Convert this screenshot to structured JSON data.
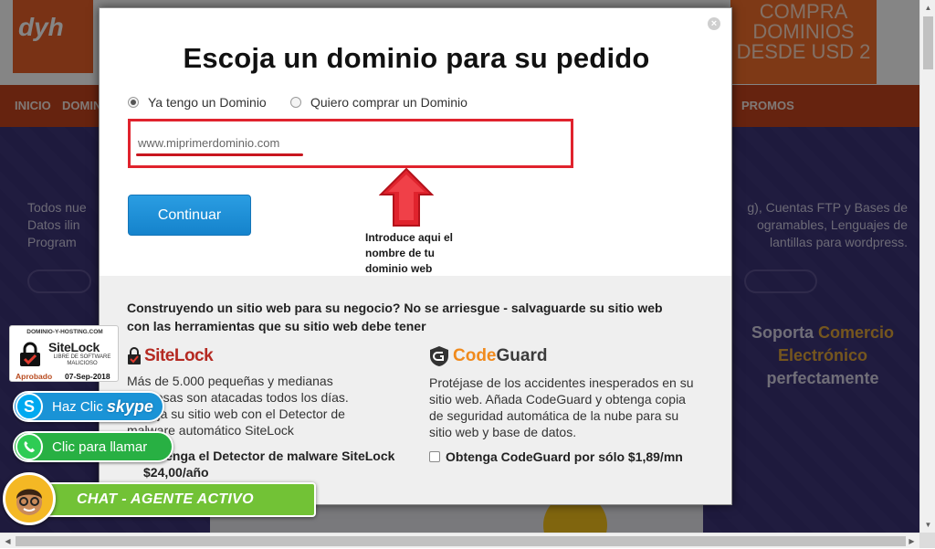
{
  "background": {
    "logo": "dyh",
    "promo_lines": [
      "COMPRA",
      "DOMINIOS",
      "DESDE USD 2"
    ],
    "nav_items": [
      "INICIO",
      "DOMINI",
      "PROMOS"
    ],
    "hero_left_lines": [
      "Todos nue",
      "Datos ilin",
      "Program"
    ],
    "hero_right_lines": [
      "g), Cuentas FTP y Bases de",
      "ogramables, Lenguajes de",
      "lantillas para wordpress."
    ],
    "soporta_prefix": "Soporta",
    "soporta_highlight": "Comercio Electrónico",
    "soporta_suffix": "perfectamente"
  },
  "modal": {
    "title": "Escoja un dominio para su pedido",
    "close_symbol": "×",
    "radio_options": [
      {
        "label": "Ya tengo un Dominio",
        "checked": true
      },
      {
        "label": "Quiero comprar un Dominio",
        "checked": false
      }
    ],
    "domain_input": {
      "value": "www.miprimerdominio.com",
      "placeholder": ""
    },
    "continue_label": "Continuar",
    "hint_text": "Introduce aqui el nombre de tu dominio web",
    "upsell": {
      "heading": "Construyendo un sitio web para su negocio? No se arriesgue - salvaguarde su sitio web con las herramientas que su sitio web debe tener",
      "sitelock": {
        "brand": "SiteLock",
        "description": "Más de 5.000 pequeñas y medianas empresas son atacadas todos los días. Proteja su sitio web con el Detector de malware automático SiteLock",
        "offer": "Obtenga el Detector de malware SiteLock $24,00/año"
      },
      "codeguard": {
        "brand_code": "Code",
        "brand_guard": "Guard",
        "description": "Protéjase de los accidentes inesperados en su sitio web. Añada CodeGuard y obtenga copia de seguridad automática de la nube para su sitio web y base de datos.",
        "offer": "Obtenga CodeGuard por sólo $1,89/mn"
      }
    }
  },
  "widgets": {
    "sitelock_badge": {
      "domain": "DOMINIO-Y-HOSTING.COM",
      "brand": "SiteLock",
      "sub1": "LIBRE DE SOFTWARE",
      "sub2": "MALICIOSO",
      "status": "Aprobado",
      "date": "07-Sep-2018"
    },
    "skype_label": "Haz Clic",
    "skype_word": "skype",
    "whatsapp_label": "Clic para llamar",
    "chat_label": "CHAT - AGENTE ACTIVO"
  }
}
